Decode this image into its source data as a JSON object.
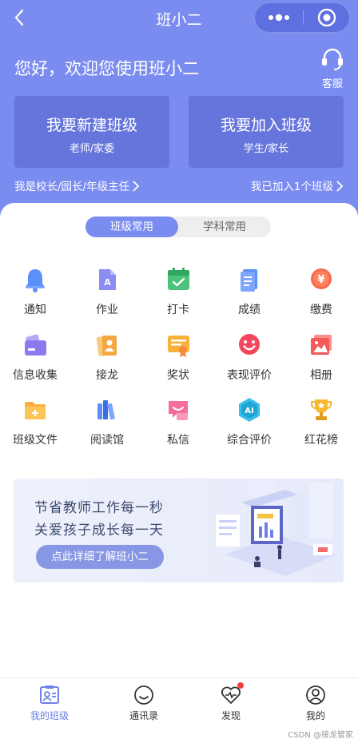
{
  "nav": {
    "title": "班小二"
  },
  "header": {
    "greeting": "您好，欢迎您使用班小二",
    "service_label": "客服",
    "create_card": {
      "title": "我要新建班级",
      "subtitle": "老师/家委"
    },
    "join_card": {
      "title": "我要加入班级",
      "subtitle": "学生/家长"
    },
    "principal_link": "我是校长/园长/年级主任",
    "joined_link": "我已加入1个班级"
  },
  "tabs": {
    "class_common": "班级常用",
    "subject_common": "学科常用"
  },
  "grid": {
    "items": [
      {
        "label": "通知",
        "icon": "bell-icon"
      },
      {
        "label": "作业",
        "icon": "homework-icon"
      },
      {
        "label": "打卡",
        "icon": "checkin-icon"
      },
      {
        "label": "成绩",
        "icon": "grades-icon"
      },
      {
        "label": "缴费",
        "icon": "payment-icon"
      },
      {
        "label": "信息收集",
        "icon": "info-collect-icon"
      },
      {
        "label": "接龙",
        "icon": "relay-icon"
      },
      {
        "label": "奖状",
        "icon": "certificate-icon"
      },
      {
        "label": "表现评价",
        "icon": "smile-icon"
      },
      {
        "label": "相册",
        "icon": "album-icon"
      },
      {
        "label": "班级文件",
        "icon": "folder-icon"
      },
      {
        "label": "阅读馆",
        "icon": "books-icon"
      },
      {
        "label": "私信",
        "icon": "message-icon"
      },
      {
        "label": "综合评价",
        "icon": "ai-icon"
      },
      {
        "label": "红花榜",
        "icon": "trophy-icon"
      }
    ]
  },
  "banner": {
    "line1": "节省教师工作每一秒",
    "line2": "关爱孩子成长每一天",
    "button": "点此详细了解班小二"
  },
  "tabbar": {
    "items": [
      {
        "label": "我的班级"
      },
      {
        "label": "通讯录"
      },
      {
        "label": "发现"
      },
      {
        "label": "我的"
      }
    ]
  },
  "watermark": "CSDN @接龙管家",
  "colors": {
    "primary": "#7b8cf0",
    "card": "#6675dc",
    "active_tab": "#6f80e8"
  }
}
